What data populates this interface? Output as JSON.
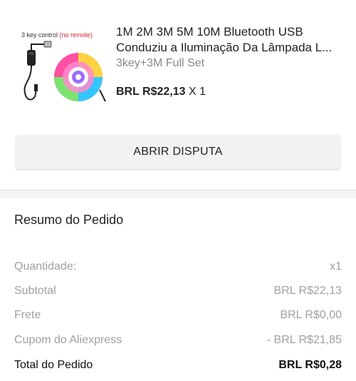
{
  "product": {
    "image_caption_main": "3 key control ",
    "image_caption_note": "(no remote)",
    "title_line1": "1M 2M 3M 5M 10M Bluetooth USB",
    "title_line2": "Conduziu a Iluminação Da Lâmpada L...",
    "variant": "3key+3M Full Set",
    "price": "BRL R$22,13",
    "quantity": "X 1"
  },
  "actions": {
    "dispute_label": "ABRIR DISPUTA"
  },
  "summary": {
    "title": "Resumo do Pedido",
    "rows": [
      {
        "label": "Quantidade:",
        "value": "x1"
      },
      {
        "label": "Subtotal",
        "value": "BRL R$22,13"
      },
      {
        "label": "Frete",
        "value": "BRL R$0,00"
      },
      {
        "label": "Cupom do Aliexpress",
        "value": "- BRL R$21,85"
      }
    ],
    "total": {
      "label": "Total do Pedido",
      "value": "BRL R$0,28"
    }
  },
  "colors": {
    "accent_red": "#d9232d",
    "muted_text": "#a0a0a0",
    "button_bg": "#f2f2f2"
  }
}
